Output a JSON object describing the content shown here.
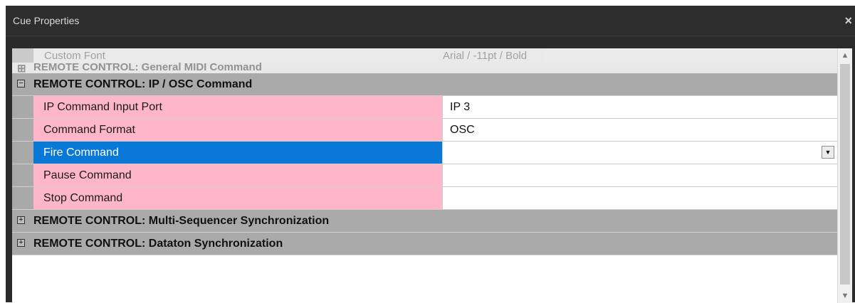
{
  "window": {
    "title": "Cue Properties",
    "close_glyph": "×"
  },
  "ghost_rows": {
    "custom_font_label": "Custom Font",
    "custom_font_value": "Arial / -11pt / Bold",
    "midi_category": "REMOTE CONTROL: General MIDI Command"
  },
  "categories": {
    "ip_osc": {
      "label": "REMOTE CONTROL: IP / OSC Command",
      "toggle": "−"
    },
    "multi_seq": {
      "label": "REMOTE CONTROL: Multi-Sequencer Synchronization",
      "toggle": "+"
    },
    "dataton": {
      "label": "REMOTE CONTROL: Dataton Synchronization",
      "toggle": "+"
    }
  },
  "properties": [
    {
      "label": "IP Command Input Port",
      "value": "IP 3"
    },
    {
      "label": "Command Format",
      "value": "OSC"
    },
    {
      "label": "Fire Command",
      "value": "",
      "selected": true
    },
    {
      "label": "Pause Command",
      "value": ""
    },
    {
      "label": "Stop Command",
      "value": ""
    }
  ],
  "colors": {
    "name_cell": "#ffb6c8",
    "selected": "#0a78d7",
    "category_bg": "#aaaaaa",
    "title_bar": "#2d2d2d"
  },
  "icons": {
    "close": "close-icon",
    "expand": "plus-box-icon",
    "collapse": "minus-box-icon",
    "dropdown": "chevron-down-icon",
    "scroll_up": "chevron-up-icon",
    "scroll_down": "chevron-down-icon"
  }
}
